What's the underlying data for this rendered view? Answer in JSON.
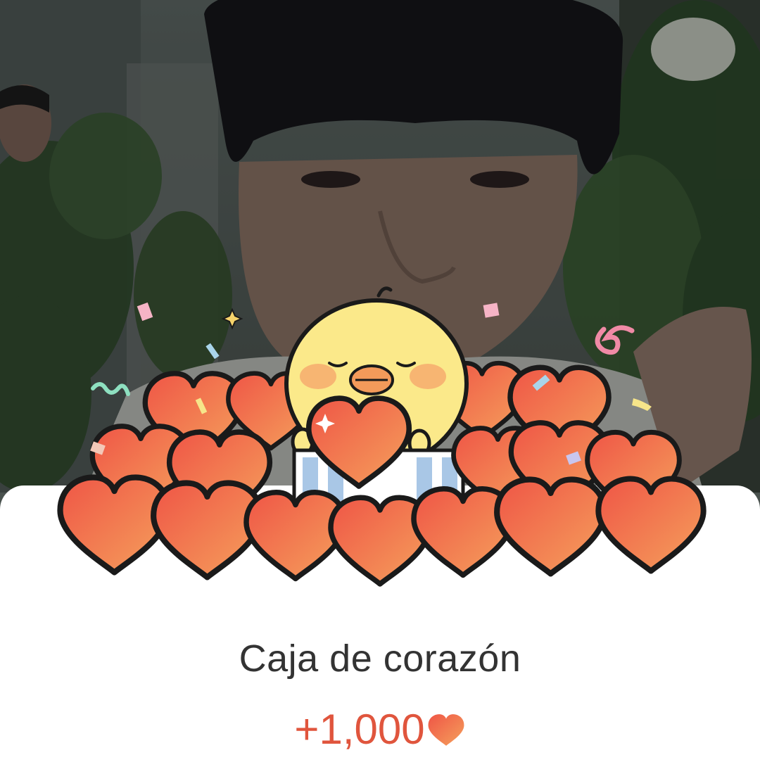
{
  "reward": {
    "title": "Caja de corazón",
    "amount": "+1,000",
    "currency_icon": "heart-icon"
  },
  "colors": {
    "heart_start": "#f05a4a",
    "heart_end": "#f39a5a",
    "accent_text": "#e0553d",
    "sheet": "#ffffff"
  },
  "illustration": {
    "character": "yellow-chick",
    "prop": "heart-box"
  }
}
